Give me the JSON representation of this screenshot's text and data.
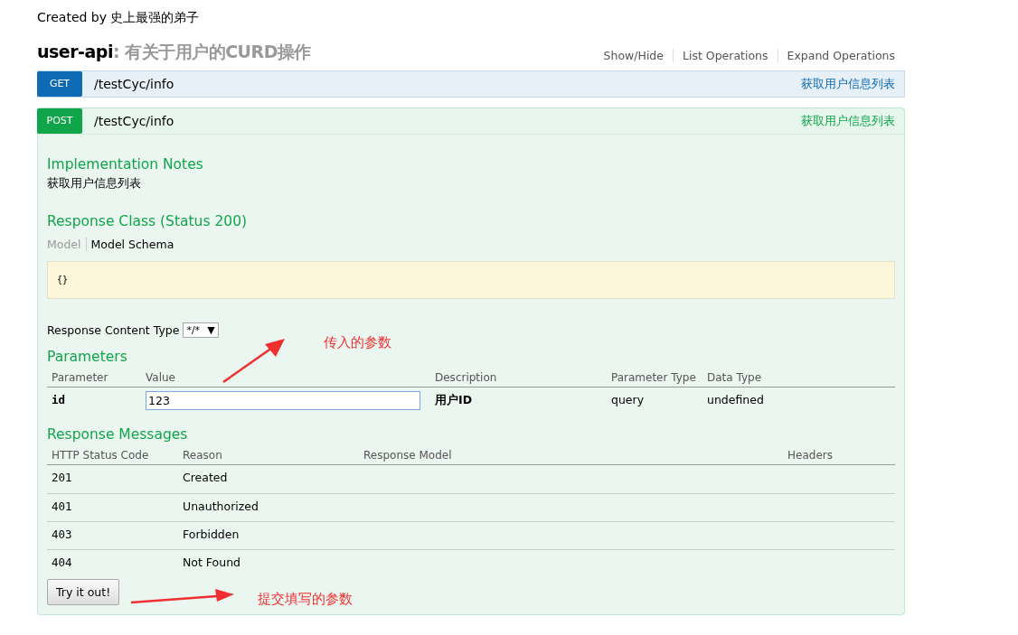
{
  "created_by": "Created by 史上最强的弟子",
  "resource": {
    "name": "user-api",
    "description": ": 有关于用户的CURD操作",
    "actions": [
      "Show/Hide",
      "List Operations",
      "Expand Operations"
    ]
  },
  "operations": [
    {
      "method": "GET",
      "path": "/testCyc/info",
      "summary": "获取用户信息列表",
      "expanded": false
    },
    {
      "method": "POST",
      "path": "/testCyc/info",
      "summary": "获取用户信息列表",
      "expanded": true,
      "details": {
        "implementation_title": "Implementation Notes",
        "implementation_notes": "获取用户信息列表",
        "response_class_title": "Response Class (Status 200)",
        "model_tabs": [
          {
            "label": "Model",
            "selected": false
          },
          {
            "label": "Model Schema",
            "selected": true
          }
        ],
        "model_schema": "{}",
        "content_type_label": "Response Content Type",
        "content_type_value": "*/*",
        "content_type_caret": "▼",
        "parameters_title": "Parameters",
        "parameter_columns": [
          "Parameter",
          "Value",
          "Description",
          "Parameter Type",
          "Data Type"
        ],
        "parameters": [
          {
            "name": "id",
            "value": "123",
            "description": "用户ID",
            "parameter_type": "query",
            "data_type": "undefined"
          }
        ],
        "responses_title": "Response Messages",
        "response_columns": [
          "HTTP Status Code",
          "Reason",
          "Response Model",
          "Headers"
        ],
        "responses": [
          {
            "code": "201",
            "reason": "Created"
          },
          {
            "code": "401",
            "reason": "Unauthorized"
          },
          {
            "code": "403",
            "reason": "Forbidden"
          },
          {
            "code": "404",
            "reason": "Not Found"
          }
        ],
        "submit": "Try it out!"
      }
    }
  ],
  "annotations": [
    "传入的参数",
    "提交填写的参数"
  ]
}
